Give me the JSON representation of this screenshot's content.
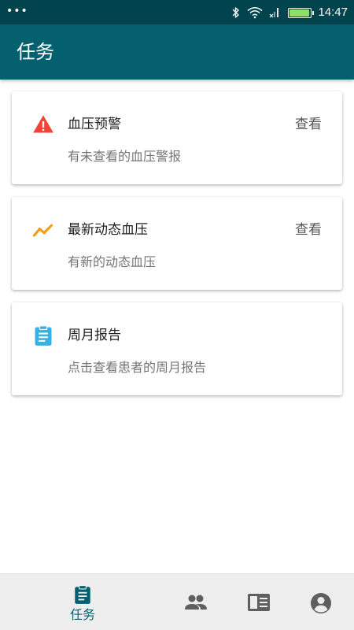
{
  "status_bar": {
    "dots": "•••",
    "time": "14:47",
    "battery_level": 0.95,
    "colors": {
      "background": "#02444e",
      "battery_fill": "#8fe06a"
    },
    "icons": [
      "bluetooth-icon",
      "wifi-icon",
      "no-signal-icon",
      "battery-icon"
    ]
  },
  "app_bar": {
    "title": "任务",
    "background": "#04606f"
  },
  "tasks": [
    {
      "icon": "warning-icon",
      "icon_color": "#f44336",
      "title": "血压预警",
      "action": "查看",
      "description": "有未查看的血压警报"
    },
    {
      "icon": "trending-icon",
      "icon_color": "#f39c12",
      "title": "最新动态血压",
      "action": "查看",
      "description": "有新的动态血压"
    },
    {
      "icon": "clipboard-icon",
      "icon_color": "#3ab0e3",
      "title": "周月报告",
      "description": "点击查看患者的周月报告"
    }
  ],
  "bottom_nav": {
    "active_color": "#04606f",
    "inactive_color": "#5f5f5f",
    "items": [
      {
        "label": "任务",
        "icon": "clipboard-icon",
        "active": true
      },
      {
        "icon": "people-icon",
        "active": false
      },
      {
        "icon": "report-icon",
        "active": false
      },
      {
        "icon": "account-icon",
        "active": false
      }
    ]
  }
}
